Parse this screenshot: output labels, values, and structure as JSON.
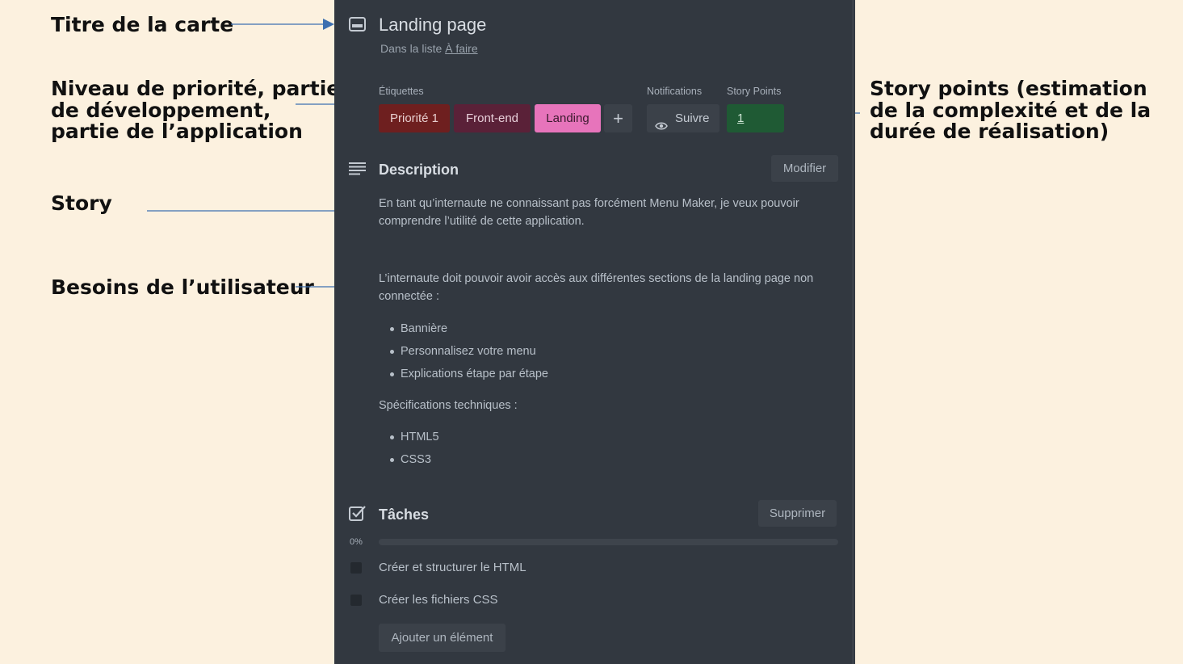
{
  "annotations": {
    "card_title": "Titre de la carte",
    "labels": [
      "Niveau de priorité, partie",
      "de développement,",
      "partie de l’application"
    ],
    "story": "Story",
    "user_needs": "Besoins de l’utilisateur",
    "story_points": [
      "Story points (estimation",
      "de la complexité et de la",
      "durée de réalisation)"
    ],
    "arrow_color": "#3d6fb0"
  },
  "card": {
    "icon": "card-icon",
    "title": "Landing page",
    "in_list_prefix": "Dans la liste",
    "in_list_link": "À faire",
    "labels_heading": "Étiquettes",
    "labels": [
      {
        "text": "Priorité 1",
        "bg": "#6e1f1f",
        "color": "#e8cfcf"
      },
      {
        "text": "Front-end",
        "bg": "#5a2138",
        "color": "#e8d0da"
      },
      {
        "text": "Landing",
        "bg": "#e774bb",
        "color": "#3a1a2d"
      }
    ],
    "add_label": "+",
    "notifications_heading": "Notifications",
    "watch_label": "Suivre",
    "story_points_heading": "Story Points",
    "story_points_value": "1",
    "story_points_bg": "#1f5a34",
    "description": {
      "icon": "description-icon",
      "title": "Description",
      "edit_label": "Modifier",
      "story": "En tant qu’internaute ne connaissant pas forcément Menu Maker, je veux pouvoir comprendre l’utilité de cette application.",
      "needs_intro": "L’internaute doit pouvoir avoir accès aux différentes sections de la landing page non connectée :",
      "needs": [
        "Bannière",
        "Personnalisez votre menu",
        "Explications étape par étape"
      ],
      "specs_intro": "Spécifications techniques :",
      "specs": [
        "HTML5",
        "CSS3"
      ]
    },
    "tasks": {
      "icon": "checklist-icon",
      "title": "Tâches",
      "delete_label": "Supprimer",
      "progress_label": "0%",
      "progress": 0,
      "items": [
        {
          "text": "Créer et structurer le HTML",
          "checked": false
        },
        {
          "text": "Créer les fichiers CSS",
          "checked": false
        }
      ],
      "add_item_label": "Ajouter un élément"
    }
  }
}
